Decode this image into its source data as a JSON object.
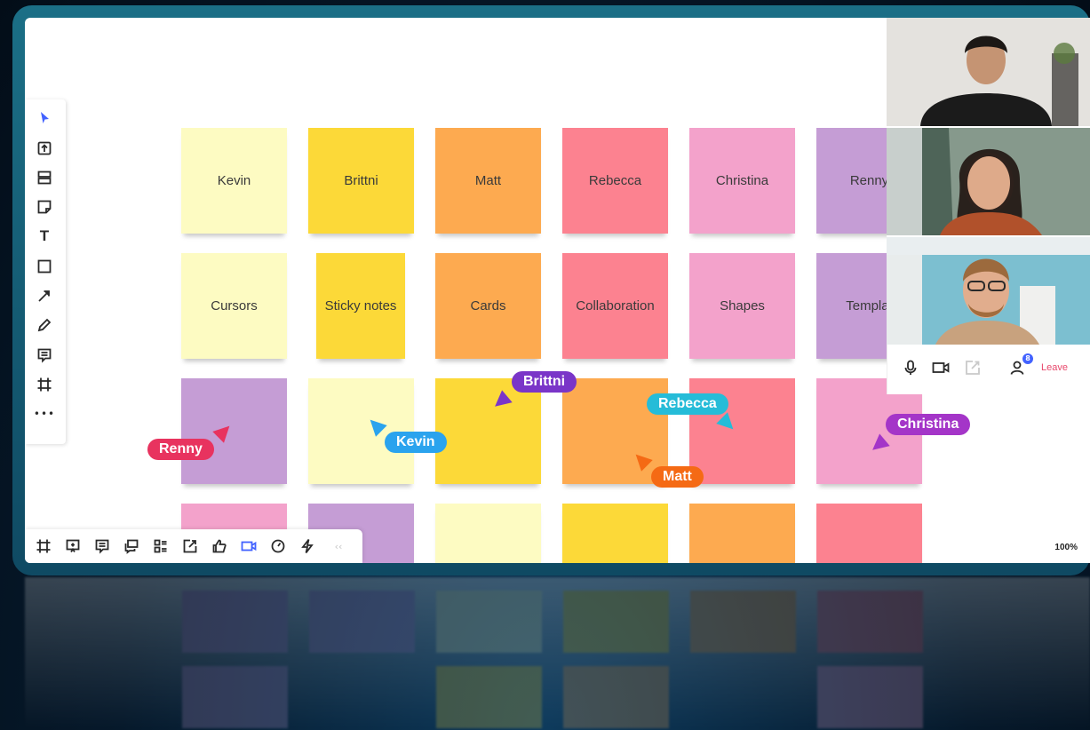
{
  "board": {
    "zoom_label": "100%",
    "colors": {
      "pale_yellow": "#fdfbc2",
      "yellow": "#fcd938",
      "orange": "#fdaa50",
      "coral": "#fc8290",
      "pink": "#f3a2cb",
      "purple": "#c59dd5"
    },
    "rows": [
      [
        {
          "text": "Kevin",
          "color": "#fdfbc2"
        },
        {
          "text": "Brittni",
          "color": "#fcd938"
        },
        {
          "text": "Matt",
          "color": "#fdaa50"
        },
        {
          "text": "Rebecca",
          "color": "#fc8290"
        },
        {
          "text": "Christina",
          "color": "#f3a2cb"
        },
        {
          "text": "Renny",
          "color": "#c59dd5"
        }
      ],
      [
        {
          "text": "Cursors",
          "color": "#fdfbc2"
        },
        {
          "text": "Sticky notes",
          "color": "#fcd938"
        },
        {
          "text": "Cards",
          "color": "#fdaa50"
        },
        {
          "text": "Collaboration",
          "color": "#fc8290"
        },
        {
          "text": "Shapes",
          "color": "#f3a2cb"
        },
        {
          "text": "Templat",
          "color": "#c59dd5"
        }
      ],
      [
        {
          "text": "",
          "color": "#c59dd5"
        },
        {
          "text": "",
          "color": "#fdfbc2"
        },
        {
          "text": "",
          "color": "#fcd938"
        },
        {
          "text": "",
          "color": "#fdaa50"
        },
        {
          "text": "",
          "color": "#fc8290"
        },
        {
          "text": "",
          "color": "#f3a2cb"
        }
      ],
      [
        {
          "text": "",
          "color": "#f3a2cb"
        },
        {
          "text": "",
          "color": "#c59dd5"
        },
        {
          "text": "",
          "color": "#fdfbc2"
        },
        {
          "text": "",
          "color": "#fcd938"
        },
        {
          "text": "",
          "color": "#fdaa50"
        },
        {
          "text": "",
          "color": "#fc8290"
        }
      ]
    ]
  },
  "cursors": [
    {
      "name": "Renny",
      "color": "#e8335f"
    },
    {
      "name": "Kevin",
      "color": "#2aa3ee"
    },
    {
      "name": "Brittni",
      "color": "#7a35c8"
    },
    {
      "name": "Rebecca",
      "color": "#25bcd8"
    },
    {
      "name": "Matt",
      "color": "#f56a14"
    },
    {
      "name": "Christina",
      "color": "#a435c8"
    }
  ],
  "left_toolbar": {
    "icons": [
      "select-icon",
      "upload-icon",
      "templates-icon",
      "sticky-note-icon",
      "text-icon",
      "shape-icon",
      "arrow-icon",
      "pen-icon",
      "comment-icon",
      "frame-icon",
      "more-icon"
    ],
    "text_tool": "T",
    "more": "•••"
  },
  "bottom_toolbar": {
    "icons": [
      "frames-icon",
      "present-icon",
      "comments-icon",
      "chat-icon",
      "cards-icon",
      "share-screen-icon",
      "like-icon",
      "video-icon",
      "timer-icon",
      "lightning-icon",
      "collapse-icon"
    ],
    "collapse": "‹‹"
  },
  "video_call": {
    "leave_label": "Leave",
    "participants_badge": "8",
    "accent": "#4262ff"
  }
}
